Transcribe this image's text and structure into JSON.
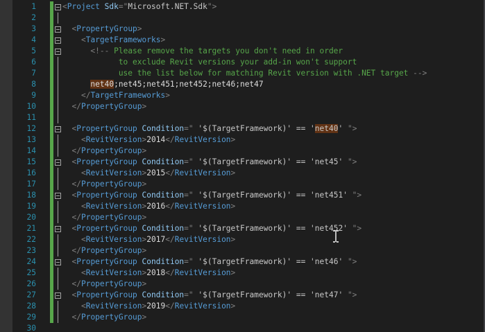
{
  "editor": {
    "lines": [
      {
        "n": "1",
        "tokens": [
          [
            "br",
            "<"
          ],
          [
            "tag",
            "Project"
          ],
          [
            "txt",
            " "
          ],
          [
            "attr",
            "Sdk"
          ],
          [
            "br",
            "=\""
          ],
          [
            "val",
            "Microsoft.NET.Sdk"
          ],
          [
            "br",
            "\">"
          ]
        ]
      },
      {
        "n": "2",
        "tokens": []
      },
      {
        "n": "3",
        "tokens": [
          [
            "txt",
            "  "
          ],
          [
            "br",
            "<"
          ],
          [
            "tag",
            "PropertyGroup"
          ],
          [
            "br",
            ">"
          ]
        ]
      },
      {
        "n": "4",
        "tokens": [
          [
            "txt",
            "    "
          ],
          [
            "br",
            "<"
          ],
          [
            "tag",
            "TargetFrameworks"
          ],
          [
            "br",
            ">"
          ]
        ]
      },
      {
        "n": "5",
        "tokens": [
          [
            "txt",
            "      "
          ],
          [
            "br",
            "<!--"
          ],
          [
            "cm",
            " Please remove the targets you don't need in order"
          ]
        ]
      },
      {
        "n": "6",
        "tokens": [
          [
            "cm",
            "            to exclude Revit versions your add-in won't support"
          ]
        ]
      },
      {
        "n": "7",
        "tokens": [
          [
            "cm",
            "            use the list below for matching Revit version with .NET target "
          ],
          [
            "br",
            "-->"
          ]
        ]
      },
      {
        "n": "8",
        "tokens": [
          [
            "txt",
            "      "
          ],
          [
            "hl",
            "net40"
          ],
          [
            "txt",
            ";net45;net451;net452;net46;net47"
          ]
        ]
      },
      {
        "n": "9",
        "tokens": [
          [
            "txt",
            "    "
          ],
          [
            "br",
            "</"
          ],
          [
            "tag",
            "TargetFrameworks"
          ],
          [
            "br",
            ">"
          ]
        ]
      },
      {
        "n": "10",
        "tokens": [
          [
            "txt",
            "  "
          ],
          [
            "br",
            "</"
          ],
          [
            "tag",
            "PropertyGroup"
          ],
          [
            "br",
            ">"
          ]
        ]
      },
      {
        "n": "11",
        "tokens": []
      },
      {
        "n": "12",
        "tokens": [
          [
            "txt",
            "  "
          ],
          [
            "br",
            "<"
          ],
          [
            "tag",
            "PropertyGroup"
          ],
          [
            "txt",
            " "
          ],
          [
            "attr",
            "Condition"
          ],
          [
            "br",
            "=\""
          ],
          [
            "val",
            " '$(TargetFramework)' == '"
          ],
          [
            "hlv",
            "net40"
          ],
          [
            "val",
            "' "
          ],
          [
            "br",
            "\">"
          ]
        ]
      },
      {
        "n": "13",
        "tokens": [
          [
            "txt",
            "    "
          ],
          [
            "br",
            "<"
          ],
          [
            "tag",
            "RevitVersion"
          ],
          [
            "br",
            ">"
          ],
          [
            "txt",
            "2014"
          ],
          [
            "br",
            "</"
          ],
          [
            "tag",
            "RevitVersion"
          ],
          [
            "br",
            ">"
          ]
        ]
      },
      {
        "n": "14",
        "tokens": [
          [
            "txt",
            "  "
          ],
          [
            "br",
            "</"
          ],
          [
            "tag",
            "PropertyGroup"
          ],
          [
            "br",
            ">"
          ]
        ]
      },
      {
        "n": "15",
        "tokens": [
          [
            "txt",
            "  "
          ],
          [
            "br",
            "<"
          ],
          [
            "tag",
            "PropertyGroup"
          ],
          [
            "txt",
            " "
          ],
          [
            "attr",
            "Condition"
          ],
          [
            "br",
            "=\""
          ],
          [
            "val",
            " '$(TargetFramework)' == 'net45' "
          ],
          [
            "br",
            "\">"
          ]
        ]
      },
      {
        "n": "16",
        "tokens": [
          [
            "txt",
            "    "
          ],
          [
            "br",
            "<"
          ],
          [
            "tag",
            "RevitVersion"
          ],
          [
            "br",
            ">"
          ],
          [
            "txt",
            "2015"
          ],
          [
            "br",
            "</"
          ],
          [
            "tag",
            "RevitVersion"
          ],
          [
            "br",
            ">"
          ]
        ]
      },
      {
        "n": "17",
        "tokens": [
          [
            "txt",
            "  "
          ],
          [
            "br",
            "</"
          ],
          [
            "tag",
            "PropertyGroup"
          ],
          [
            "br",
            ">"
          ]
        ]
      },
      {
        "n": "18",
        "tokens": [
          [
            "txt",
            "  "
          ],
          [
            "br",
            "<"
          ],
          [
            "tag",
            "PropertyGroup"
          ],
          [
            "txt",
            " "
          ],
          [
            "attr",
            "Condition"
          ],
          [
            "br",
            "=\""
          ],
          [
            "val",
            " '$(TargetFramework)' == 'net451' "
          ],
          [
            "br",
            "\">"
          ]
        ]
      },
      {
        "n": "19",
        "tokens": [
          [
            "txt",
            "    "
          ],
          [
            "br",
            "<"
          ],
          [
            "tag",
            "RevitVersion"
          ],
          [
            "br",
            ">"
          ],
          [
            "txt",
            "2016"
          ],
          [
            "br",
            "</"
          ],
          [
            "tag",
            "RevitVersion"
          ],
          [
            "br",
            ">"
          ]
        ]
      },
      {
        "n": "20",
        "tokens": [
          [
            "txt",
            "  "
          ],
          [
            "br",
            "</"
          ],
          [
            "tag",
            "PropertyGroup"
          ],
          [
            "br",
            ">"
          ]
        ]
      },
      {
        "n": "21",
        "tokens": [
          [
            "txt",
            "  "
          ],
          [
            "br",
            "<"
          ],
          [
            "tag",
            "PropertyGroup"
          ],
          [
            "txt",
            " "
          ],
          [
            "attr",
            "Condition"
          ],
          [
            "br",
            "=\""
          ],
          [
            "val",
            " '$(TargetFramework)' == 'net452' "
          ],
          [
            "br",
            "\">"
          ]
        ]
      },
      {
        "n": "22",
        "tokens": [
          [
            "txt",
            "    "
          ],
          [
            "br",
            "<"
          ],
          [
            "tag",
            "RevitVersion"
          ],
          [
            "br",
            ">"
          ],
          [
            "txt",
            "2017"
          ],
          [
            "br",
            "</"
          ],
          [
            "tag",
            "RevitVersion"
          ],
          [
            "br",
            ">"
          ]
        ]
      },
      {
        "n": "23",
        "tokens": [
          [
            "txt",
            "  "
          ],
          [
            "br",
            "</"
          ],
          [
            "tag",
            "PropertyGroup"
          ],
          [
            "br",
            ">"
          ]
        ]
      },
      {
        "n": "24",
        "tokens": [
          [
            "txt",
            "  "
          ],
          [
            "br",
            "<"
          ],
          [
            "tag",
            "PropertyGroup"
          ],
          [
            "txt",
            " "
          ],
          [
            "attr",
            "Condition"
          ],
          [
            "br",
            "=\""
          ],
          [
            "val",
            " '$(TargetFramework)' == 'net46' "
          ],
          [
            "br",
            "\">"
          ]
        ]
      },
      {
        "n": "25",
        "tokens": [
          [
            "txt",
            "    "
          ],
          [
            "br",
            "<"
          ],
          [
            "tag",
            "RevitVersion"
          ],
          [
            "br",
            ">"
          ],
          [
            "txt",
            "2018"
          ],
          [
            "br",
            "</"
          ],
          [
            "tag",
            "RevitVersion"
          ],
          [
            "br",
            ">"
          ]
        ]
      },
      {
        "n": "26",
        "tokens": [
          [
            "txt",
            "  "
          ],
          [
            "br",
            "</"
          ],
          [
            "tag",
            "PropertyGroup"
          ],
          [
            "br",
            ">"
          ]
        ]
      },
      {
        "n": "27",
        "tokens": [
          [
            "txt",
            "  "
          ],
          [
            "br",
            "<"
          ],
          [
            "tag",
            "PropertyGroup"
          ],
          [
            "txt",
            " "
          ],
          [
            "attr",
            "Condition"
          ],
          [
            "br",
            "=\""
          ],
          [
            "val",
            " '$(TargetFramework)' == 'net47' "
          ],
          [
            "br",
            "\">"
          ]
        ]
      },
      {
        "n": "28",
        "tokens": [
          [
            "txt",
            "    "
          ],
          [
            "br",
            "<"
          ],
          [
            "tag",
            "RevitVersion"
          ],
          [
            "br",
            ">"
          ],
          [
            "txt",
            "2019"
          ],
          [
            "br",
            "</"
          ],
          [
            "tag",
            "RevitVersion"
          ],
          [
            "br",
            ">"
          ]
        ]
      },
      {
        "n": "29",
        "tokens": [
          [
            "txt",
            "  "
          ],
          [
            "br",
            "</"
          ],
          [
            "tag",
            "PropertyGroup"
          ],
          [
            "br",
            ">"
          ]
        ]
      },
      {
        "n": "30",
        "tokens": []
      }
    ],
    "folds": [
      "1",
      "3",
      "4",
      "5",
      "12",
      "15",
      "18",
      "21",
      "24",
      "27"
    ],
    "changed_color": "#57a64a",
    "cursor_icon": "text-cursor-icon"
  }
}
